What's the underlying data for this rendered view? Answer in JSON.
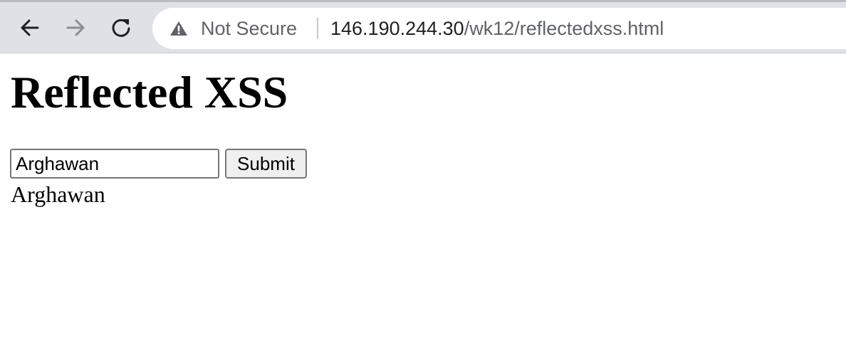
{
  "browser": {
    "security_label": "Not Secure",
    "url_host": "146.190.244.30",
    "url_path": "/wk12/reflectedxss.html",
    "icons": [
      "back-arrow-icon",
      "forward-arrow-icon",
      "reload-icon",
      "warning-icon"
    ]
  },
  "page": {
    "title": "Reflected XSS",
    "input_value": "Arghawan",
    "submit_label": "Submit",
    "reflected_output": "Arghawan"
  }
}
